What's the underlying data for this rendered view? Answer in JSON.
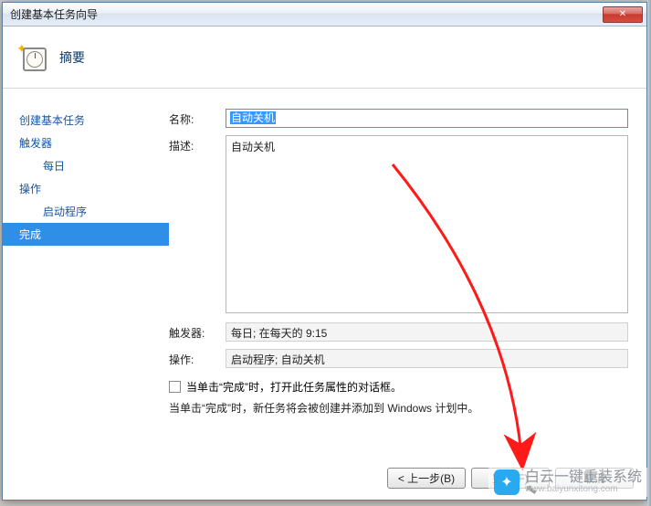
{
  "window": {
    "title": "创建基本任务向导",
    "close_label": "✕"
  },
  "header": {
    "title": "摘要"
  },
  "sidebar": {
    "items": [
      {
        "label": "创建基本任务",
        "level": 1,
        "selected": false
      },
      {
        "label": "触发器",
        "level": 1,
        "selected": false
      },
      {
        "label": "每日",
        "level": 2,
        "selected": false
      },
      {
        "label": "操作",
        "level": 1,
        "selected": false
      },
      {
        "label": "启动程序",
        "level": 2,
        "selected": false
      },
      {
        "label": "完成",
        "level": 1,
        "selected": true
      }
    ]
  },
  "form": {
    "name_label": "名称:",
    "name_value": "自动关机",
    "desc_label": "描述:",
    "desc_value": "自动关机",
    "trigger_label": "触发器:",
    "trigger_value": "每日; 在每天的 9:15",
    "action_label": "操作:",
    "action_value": "启动程序; 自动关机",
    "checkbox_label": "当单击“完成”时，打开此任务属性的对话框。",
    "info_text": "当单击“完成”时，新任务将会被创建并添加到 Windows 计划中。"
  },
  "buttons": {
    "back": "< 上一步(B)",
    "finish": "完成(F)",
    "cancel": "取消"
  },
  "watermark": {
    "text": "白云一键重装系统",
    "url": "www.baiyunxitong.com"
  }
}
